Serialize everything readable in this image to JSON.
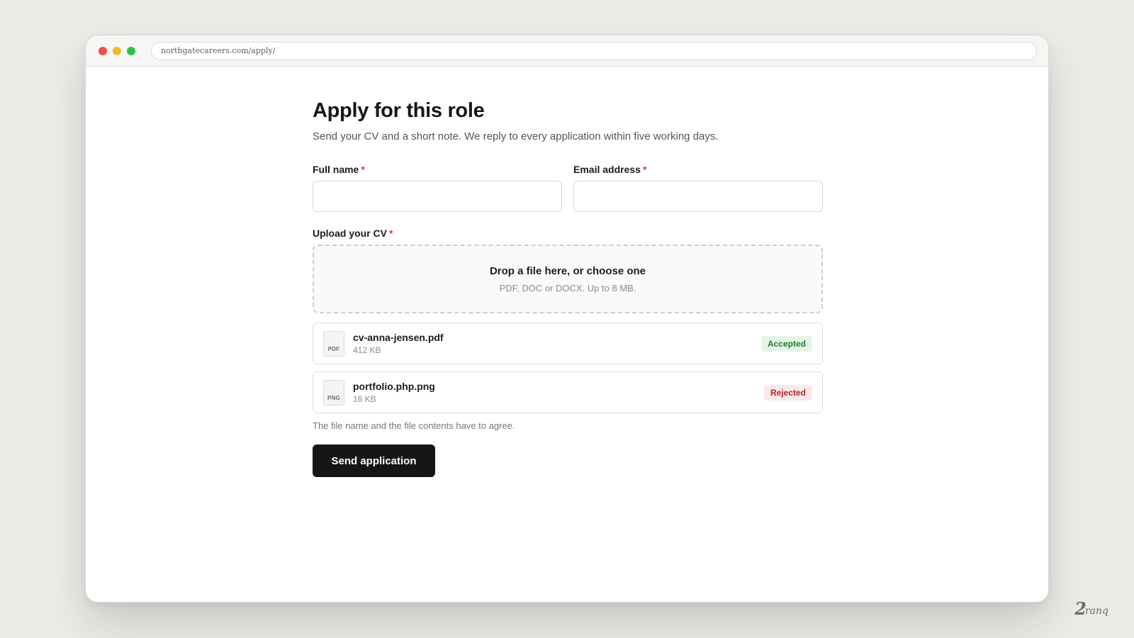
{
  "browser": {
    "url": "northgatecareers.com/apply/"
  },
  "form": {
    "title": "Apply for this role",
    "subtitle": "Send your CV and a short note. We reply to every application within five working days.",
    "required_marker": "*",
    "fields": {
      "full_name": {
        "label": "Full name",
        "value": "",
        "placeholder": ""
      },
      "email": {
        "label": "Email address",
        "value": "",
        "placeholder": ""
      }
    },
    "upload": {
      "label": "Upload your CV",
      "dropzone_title": "Drop a file here, or choose one",
      "dropzone_hint": "PDF, DOC or DOCX. Up to 8 MB."
    },
    "files": [
      {
        "icon": "PDF",
        "name": "cv-anna-jensen.pdf",
        "size": "412 KB",
        "status": "Accepted",
        "status_color": "#1f7a33"
      },
      {
        "icon": "PNG",
        "name": "portfolio.php.png",
        "size": "18 KB",
        "status": "Rejected",
        "status_color": "#b42323"
      }
    ],
    "helper_text": "The file name and the file contents have to agree.",
    "submit_label": "Send application"
  },
  "watermark": {
    "text": "2 ranq"
  },
  "colors": {
    "accent": "#161616",
    "required": "#d63a3a",
    "accepted": "#1f7a33",
    "rejected": "#b42323"
  }
}
